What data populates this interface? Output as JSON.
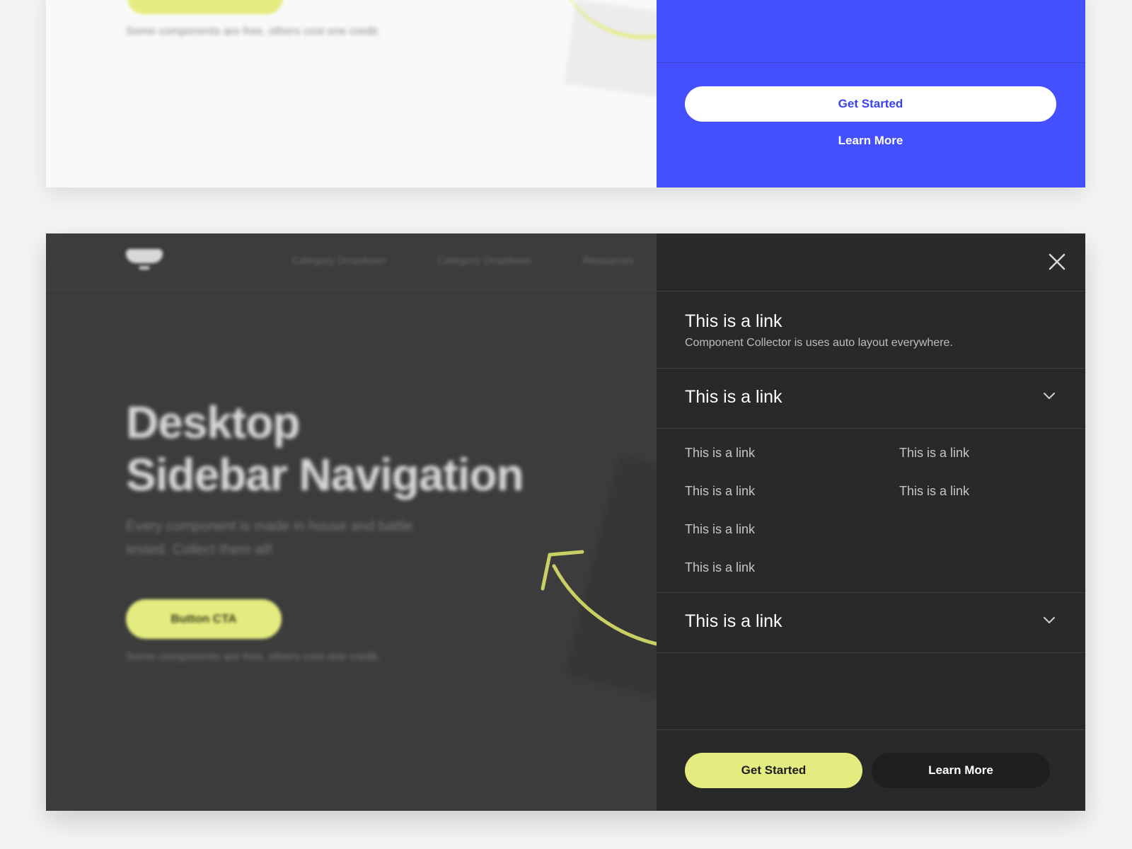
{
  "top_preview": {
    "footnote": "Some components are free, others cost one credit.",
    "get_started_label": "Get Started",
    "learn_more_label": "Learn More"
  },
  "background_page": {
    "nav": [
      "Category Dropdown",
      "Category Dropdown",
      "Resources"
    ],
    "hero_title_line1": "Desktop",
    "hero_title_line2": "Sidebar Navigation",
    "hero_subtitle": "Every component is made in house and battle tested. Collect them all!",
    "cta_label": "Button CTA",
    "footnote": "Some components are free, others cost one credit."
  },
  "sidebar": {
    "close_icon": "close-icon",
    "link_block": {
      "title": "This is a link",
      "description": "Component Collector is uses auto layout everywhere."
    },
    "accordion_1": {
      "title": "This is a link",
      "icon": "chevron-down-icon"
    },
    "sublinks_left": [
      "This is a link",
      "This is a link",
      "This is a link",
      "This is a link"
    ],
    "sublinks_right": [
      "This is a link",
      "This is a link"
    ],
    "accordion_2": {
      "title": "This is a link",
      "icon": "chevron-down-icon"
    },
    "footer": {
      "get_started_label": "Get Started",
      "learn_more_label": "Learn More"
    }
  },
  "colors": {
    "accent_blue": "#444ffd",
    "accent_yellow": "#e5ec7f",
    "sidebar_bg": "#292929",
    "page_bg_dark": "#3c3c3c"
  }
}
